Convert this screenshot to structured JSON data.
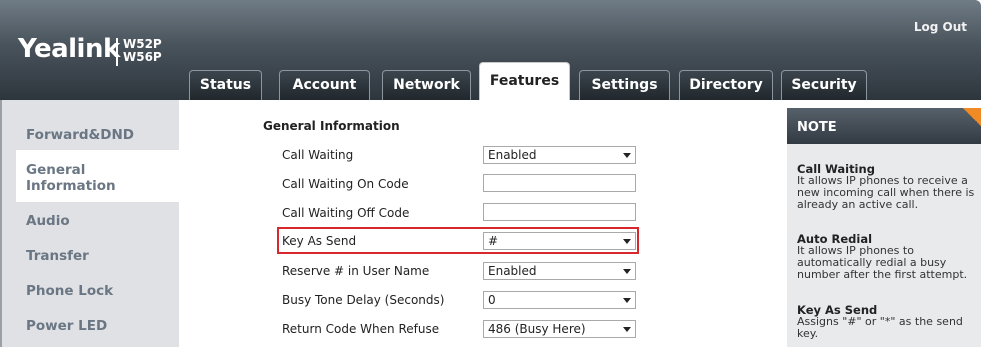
{
  "header": {
    "brand": "Yealink",
    "model_line1": "W52P",
    "model_line2": "W56P",
    "logout": "Log Out"
  },
  "tabs": [
    {
      "label": "Status",
      "active": false
    },
    {
      "label": "Account",
      "active": false
    },
    {
      "label": "Network",
      "active": false
    },
    {
      "label": "Features",
      "active": true
    },
    {
      "label": "Settings",
      "active": false
    },
    {
      "label": "Directory",
      "active": false
    },
    {
      "label": "Security",
      "active": false
    }
  ],
  "sidebar": {
    "items": [
      {
        "label": "Forward&DND"
      },
      {
        "label": "General Information",
        "line1": "General",
        "line2": "Information",
        "active": true
      },
      {
        "label": "Audio"
      },
      {
        "label": "Transfer"
      },
      {
        "label": "Phone Lock"
      },
      {
        "label": "Power LED"
      }
    ]
  },
  "form": {
    "section_title": "General Information",
    "rows": [
      {
        "label": "Call Waiting",
        "type": "select",
        "value": "Enabled"
      },
      {
        "label": "Call Waiting On Code",
        "type": "text",
        "value": ""
      },
      {
        "label": "Call Waiting Off Code",
        "type": "text",
        "value": ""
      },
      {
        "label": "Key As Send",
        "type": "select",
        "value": "#",
        "highlighted": true
      },
      {
        "label": "Reserve # in User Name",
        "type": "select",
        "value": "Enabled"
      },
      {
        "label": "Busy Tone Delay (Seconds)",
        "type": "select",
        "value": "0"
      },
      {
        "label": "Return Code When Refuse",
        "type": "select",
        "value": "486 (Busy Here)"
      }
    ]
  },
  "note": {
    "title": "NOTE",
    "entries": [
      {
        "title": "Call Waiting",
        "lines": [
          "It allows IP phones to receive a",
          "new incoming call when there is",
          "already an active call."
        ]
      },
      {
        "title": "Auto Redial",
        "lines": [
          "It allows IP phones to",
          "automatically redial a busy",
          "number after the first attempt."
        ]
      },
      {
        "title": "Key As Send",
        "lines": [
          "Assigns \"#\" or \"*\" as the send",
          "key."
        ]
      }
    ]
  },
  "colors": {
    "highlight_border": "#d9272e",
    "note_corner": "#f08a24",
    "nav_text": "#6a7683"
  }
}
